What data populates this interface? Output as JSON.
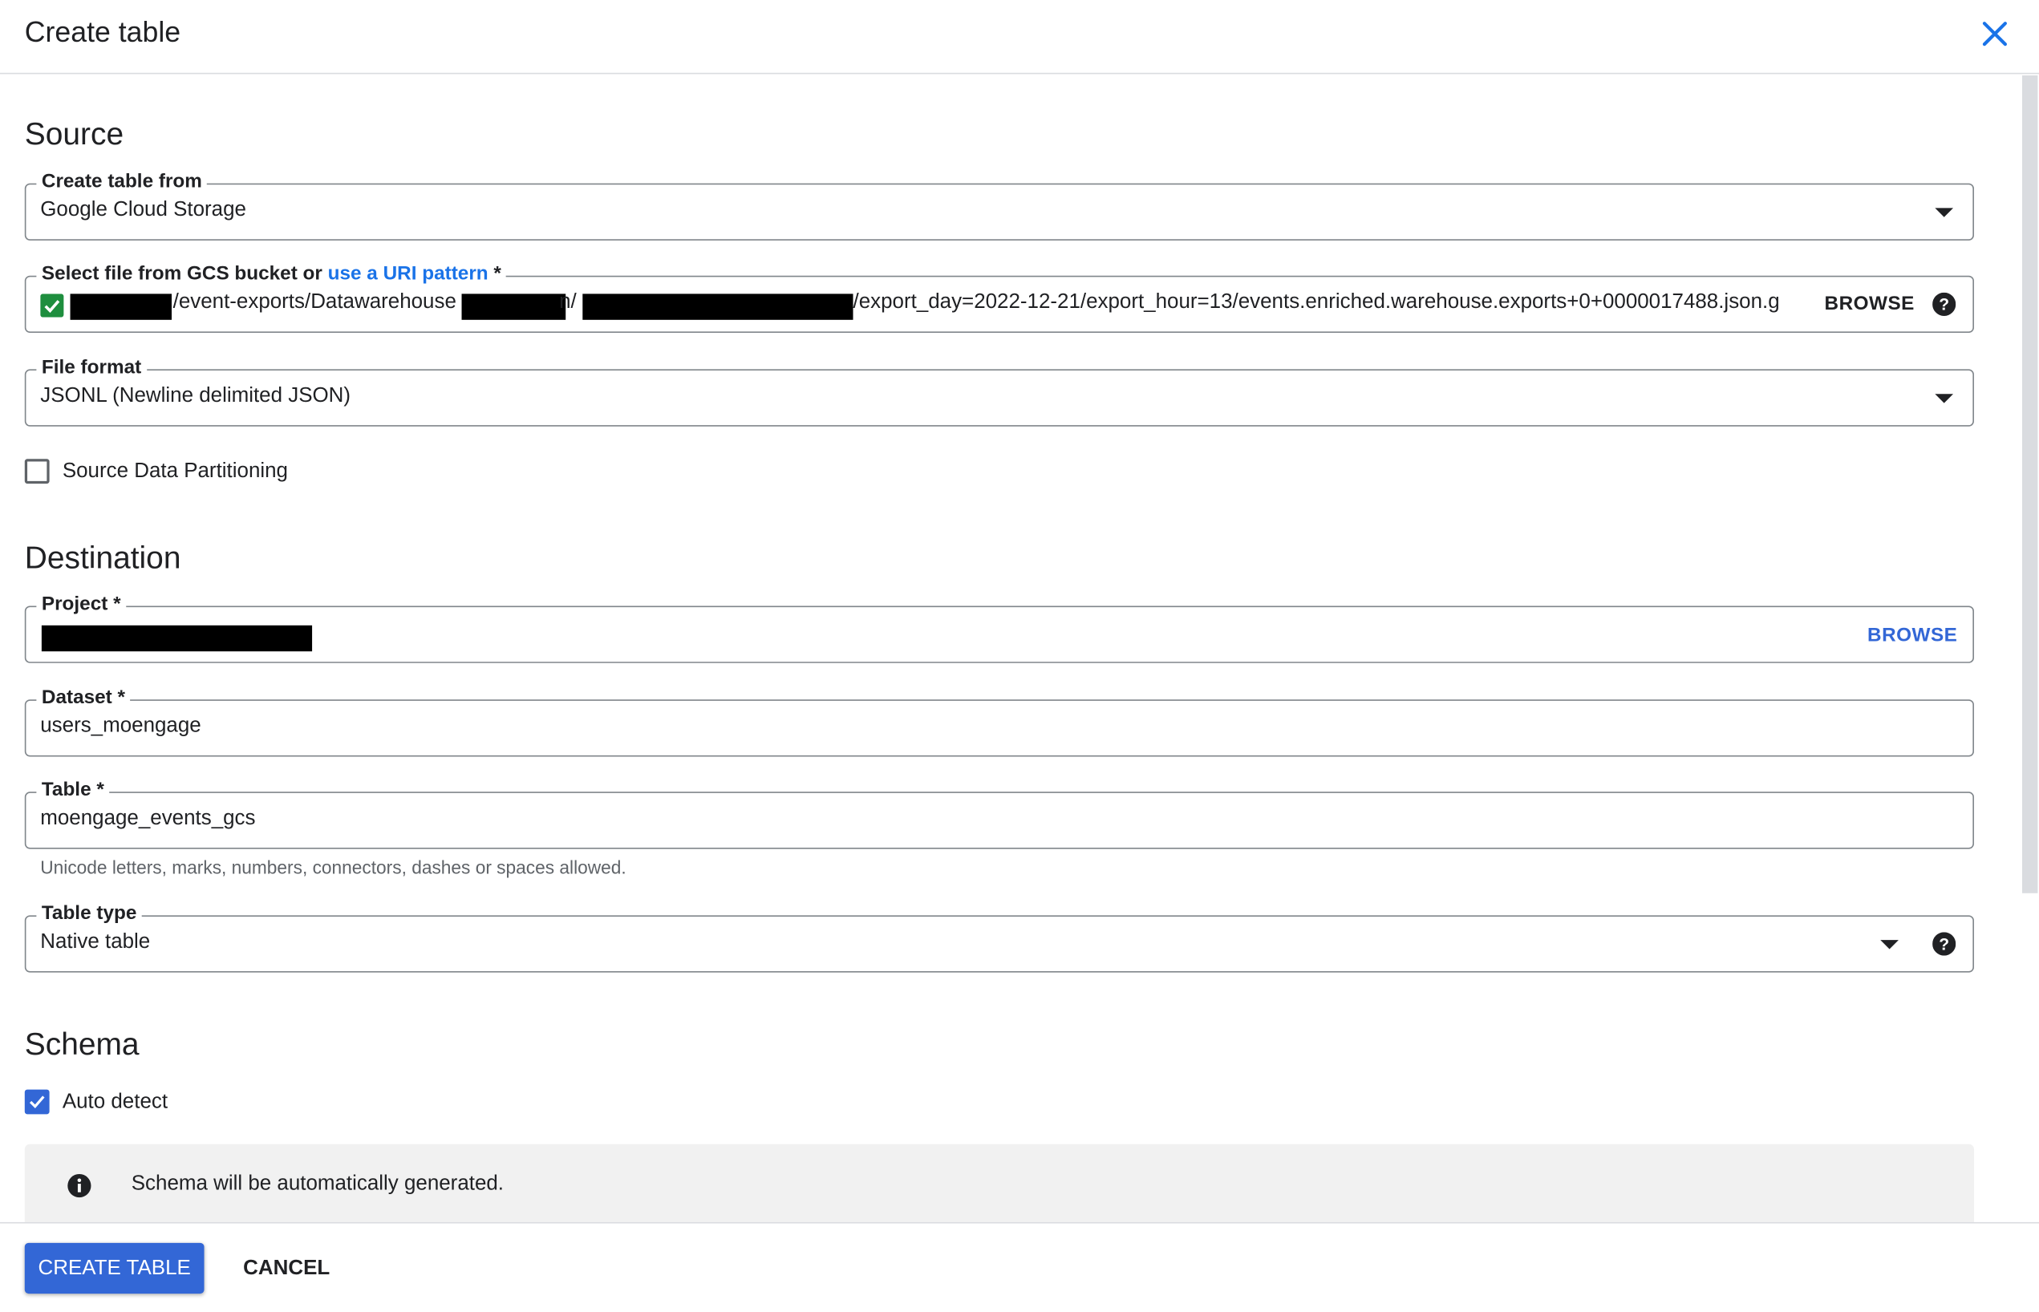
{
  "dialog": {
    "title": "Create table"
  },
  "source": {
    "heading": "Source",
    "create_from": {
      "label": "Create table from",
      "value": "Google Cloud Storage"
    },
    "gcs_file": {
      "label_prefix": "Select file from GCS bucket or ",
      "label_link": "use a URI pattern",
      "label_suffix": " *",
      "path_part1": "/event-exports/Datawarehouse",
      "path_part2": "n/",
      "path_part3": "/export_day=2022-12-21/export_hour=13/events.enriched.warehouse.exports+0+0000017488.json.g",
      "browse_label": "BROWSE"
    },
    "file_format": {
      "label": "File format",
      "value": "JSONL (Newline delimited JSON)"
    },
    "partitioning_label": "Source Data Partitioning"
  },
  "destination": {
    "heading": "Destination",
    "project": {
      "label": "Project *",
      "browse_label": "BROWSE"
    },
    "dataset": {
      "label": "Dataset *",
      "value": "users_moengage"
    },
    "table": {
      "label": "Table *",
      "value": "moengage_events_gcs",
      "hint": "Unicode letters, marks, numbers, connectors, dashes or spaces allowed."
    },
    "table_type": {
      "label": "Table type",
      "value": "Native table"
    }
  },
  "schema": {
    "heading": "Schema",
    "auto_detect_label": "Auto detect",
    "info_message": "Schema will be automatically generated."
  },
  "footer": {
    "create_label": "CREATE TABLE",
    "cancel_label": "CANCEL"
  },
  "colors": {
    "accent": "#3367d6",
    "link": "#1a73e8",
    "check_green": "#1e8e3e"
  }
}
